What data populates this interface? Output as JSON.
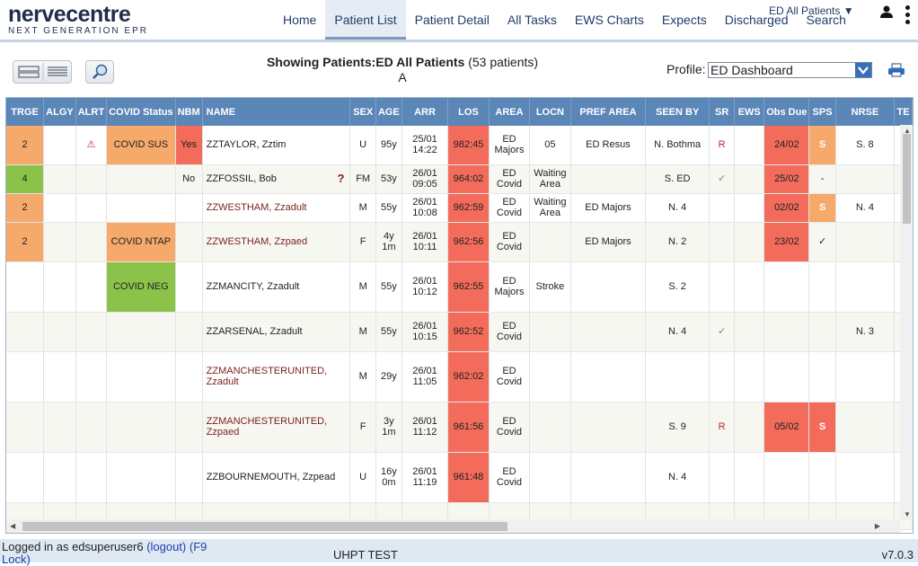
{
  "brand": {
    "name": "nervecentre",
    "tagline": "NEXT GENERATION EPR"
  },
  "nav": [
    "Home",
    "Patient List",
    "Patient Detail",
    "All Tasks",
    "EWS Charts",
    "Expects",
    "Discharged",
    "Search"
  ],
  "active_nav": "Patient List",
  "filter": "ED All Patients ▼",
  "toolbar": {
    "showing_prefix": "Showing Patients:",
    "list_name": "ED All Patients",
    "count": "(53 patients)",
    "letter": "A",
    "profile_label": "Profile:",
    "profile_value": "ED Dashboard"
  },
  "columns": [
    "TRGE",
    "ALGY",
    "ALRT",
    "COVID Status",
    "NBM",
    "NAME",
    "SEX",
    "AGE",
    "ARR",
    "LOS",
    "AREA",
    "LOCN",
    "PREF AREA",
    "SEEN BY",
    "SR",
    "EWS",
    "Obs Due",
    "SPS",
    "NRSE",
    "TE"
  ],
  "rows": [
    {
      "trge": "2",
      "trge_c": "orange",
      "alrt": "⚠",
      "covid": "COVID SUS",
      "covid_c": "orange",
      "nbm": "Yes",
      "nbm_c": "red",
      "name": "ZZTAYLOR, Zztim",
      "name_c": "",
      "q": "",
      "sex": "U",
      "age": "95y",
      "arr": "25/01 14:22",
      "los": "982:45",
      "area": "ED Majors",
      "locn": "05",
      "pref": "ED Resus",
      "seen": "N. Bothma",
      "sr": "R",
      "ews": "",
      "obs": "24/02",
      "obs_c": "red",
      "sps": "S",
      "sps_c": "orange",
      "nrse": "S. 8",
      "h": 43
    },
    {
      "trge": "4",
      "trge_c": "green",
      "alrt": "",
      "covid": "",
      "covid_c": "",
      "nbm": "No",
      "nbm_c": "",
      "name": "ZZFOSSIL, Bob",
      "name_c": "",
      "q": "?",
      "sex": "FM",
      "age": "53y",
      "arr": "26/01 09:05",
      "los": "964:02",
      "area": "ED Covid",
      "locn": "Waiting Area",
      "pref": "",
      "seen": "S. ED",
      "sr": "✓",
      "ews": "",
      "obs": "25/02",
      "obs_c": "red",
      "sps": "-",
      "sps_c": "",
      "nrse": "",
      "h": 32
    },
    {
      "trge": "2",
      "trge_c": "orange",
      "alrt": "",
      "covid": "",
      "covid_c": "",
      "nbm": "",
      "nbm_c": "",
      "name": "ZZWESTHAM, Zzadult",
      "name_c": "maroon",
      "q": "",
      "sex": "M",
      "age": "55y",
      "arr": "26/01 10:08",
      "los": "962:59",
      "area": "ED Covid",
      "locn": "Waiting Area",
      "pref": "ED Majors",
      "seen": "N. 4",
      "sr": "",
      "ews": "",
      "obs": "02/02",
      "obs_c": "red",
      "sps": "S",
      "sps_c": "orange",
      "nrse": "N. 4",
      "h": 32
    },
    {
      "trge": "2",
      "trge_c": "orange",
      "alrt": "",
      "covid": "COVID NTAP",
      "covid_c": "orange",
      "nbm": "",
      "nbm_c": "",
      "name": "ZZWESTHAM, Zzpaed",
      "name_c": "maroon",
      "q": "",
      "sex": "F",
      "age": "4y 1m",
      "arr": "26/01 10:11",
      "los": "962:56",
      "area": "ED Covid",
      "locn": "",
      "pref": "ED Majors",
      "seen": "N. 2",
      "sr": "",
      "ews": "",
      "obs": "23/02",
      "obs_c": "red",
      "sps": "✓",
      "sps_c": "",
      "nrse": "",
      "h": 44
    },
    {
      "trge": "",
      "trge_c": "",
      "alrt": "",
      "covid": "COVID NEG",
      "covid_c": "green",
      "nbm": "",
      "nbm_c": "",
      "name": "ZZMANCITY, Zzadult",
      "name_c": "",
      "q": "",
      "sex": "M",
      "age": "55y",
      "arr": "26/01 10:12",
      "los": "962:55",
      "area": "ED Majors",
      "locn": "Stroke",
      "pref": "",
      "seen": "S. 2",
      "sr": "",
      "ews": "",
      "obs": "",
      "obs_c": "",
      "sps": "",
      "sps_c": "",
      "nrse": "",
      "h": 56
    },
    {
      "trge": "",
      "trge_c": "",
      "alrt": "",
      "covid": "",
      "covid_c": "",
      "nbm": "",
      "nbm_c": "",
      "name": "ZZARSENAL, Zzadult",
      "name_c": "",
      "q": "",
      "sex": "M",
      "age": "55y",
      "arr": "26/01 10:15",
      "los": "962:52",
      "area": "ED Covid",
      "locn": "",
      "pref": "",
      "seen": "N. 4",
      "sr": "✓",
      "ews": "",
      "obs": "",
      "obs_c": "",
      "sps": "",
      "sps_c": "",
      "nrse": "N. 3",
      "h": 44
    },
    {
      "trge": "",
      "trge_c": "",
      "alrt": "",
      "covid": "",
      "covid_c": "",
      "nbm": "",
      "nbm_c": "",
      "name": "ZZMANCHESTERUNITED, Zzadult",
      "name_c": "maroon",
      "q": "",
      "sex": "M",
      "age": "29y",
      "arr": "26/01 11:05",
      "los": "962:02",
      "area": "ED Covid",
      "locn": "",
      "pref": "",
      "seen": "",
      "sr": "",
      "ews": "",
      "obs": "",
      "obs_c": "",
      "sps": "",
      "sps_c": "",
      "nrse": "",
      "h": 56
    },
    {
      "trge": "",
      "trge_c": "",
      "alrt": "",
      "covid": "",
      "covid_c": "",
      "nbm": "",
      "nbm_c": "",
      "name": "ZZMANCHESTERUNITED, Zzpaed",
      "name_c": "maroon",
      "q": "",
      "sex": "F",
      "age": "3y 1m",
      "arr": "26/01 11:12",
      "los": "961:56",
      "area": "ED Covid",
      "locn": "",
      "pref": "",
      "seen": "S. 9",
      "sr": "R",
      "ews": "",
      "obs": "05/02",
      "obs_c": "red",
      "sps": "S",
      "sps_c": "red",
      "nrse": "",
      "h": 56
    },
    {
      "trge": "",
      "trge_c": "",
      "alrt": "",
      "covid": "",
      "covid_c": "",
      "nbm": "",
      "nbm_c": "",
      "name": "ZZBOURNEMOUTH, Zzpead",
      "name_c": "",
      "q": "",
      "sex": "U",
      "age": "16y 0m",
      "arr": "26/01 11:19",
      "los": "961:48",
      "area": "ED Covid",
      "locn": "",
      "pref": "",
      "seen": "N. 4",
      "sr": "",
      "ews": "",
      "obs": "",
      "obs_c": "",
      "sps": "",
      "sps_c": "",
      "nrse": "",
      "h": 56
    },
    {
      "trge": "",
      "trge_c": "",
      "alrt": "",
      "covid": "",
      "covid_c": "",
      "nbm": "",
      "nbm_c": "",
      "name": "",
      "name_c": "",
      "q": "",
      "sex": "",
      "age": "",
      "arr": "",
      "los": "",
      "area": "",
      "locn": "",
      "pref": "",
      "seen": "",
      "sr": "",
      "ews": "",
      "obs": "",
      "obs_c": "",
      "sps": "",
      "sps_c": "",
      "nrse": "",
      "h": 30
    }
  ],
  "footer": {
    "logged_in": "Logged in as edsuperuser6",
    "logout": "(logout)",
    "lock": "(F9 Lock)",
    "env": "UHPT TEST",
    "version": "v7.0.3"
  }
}
